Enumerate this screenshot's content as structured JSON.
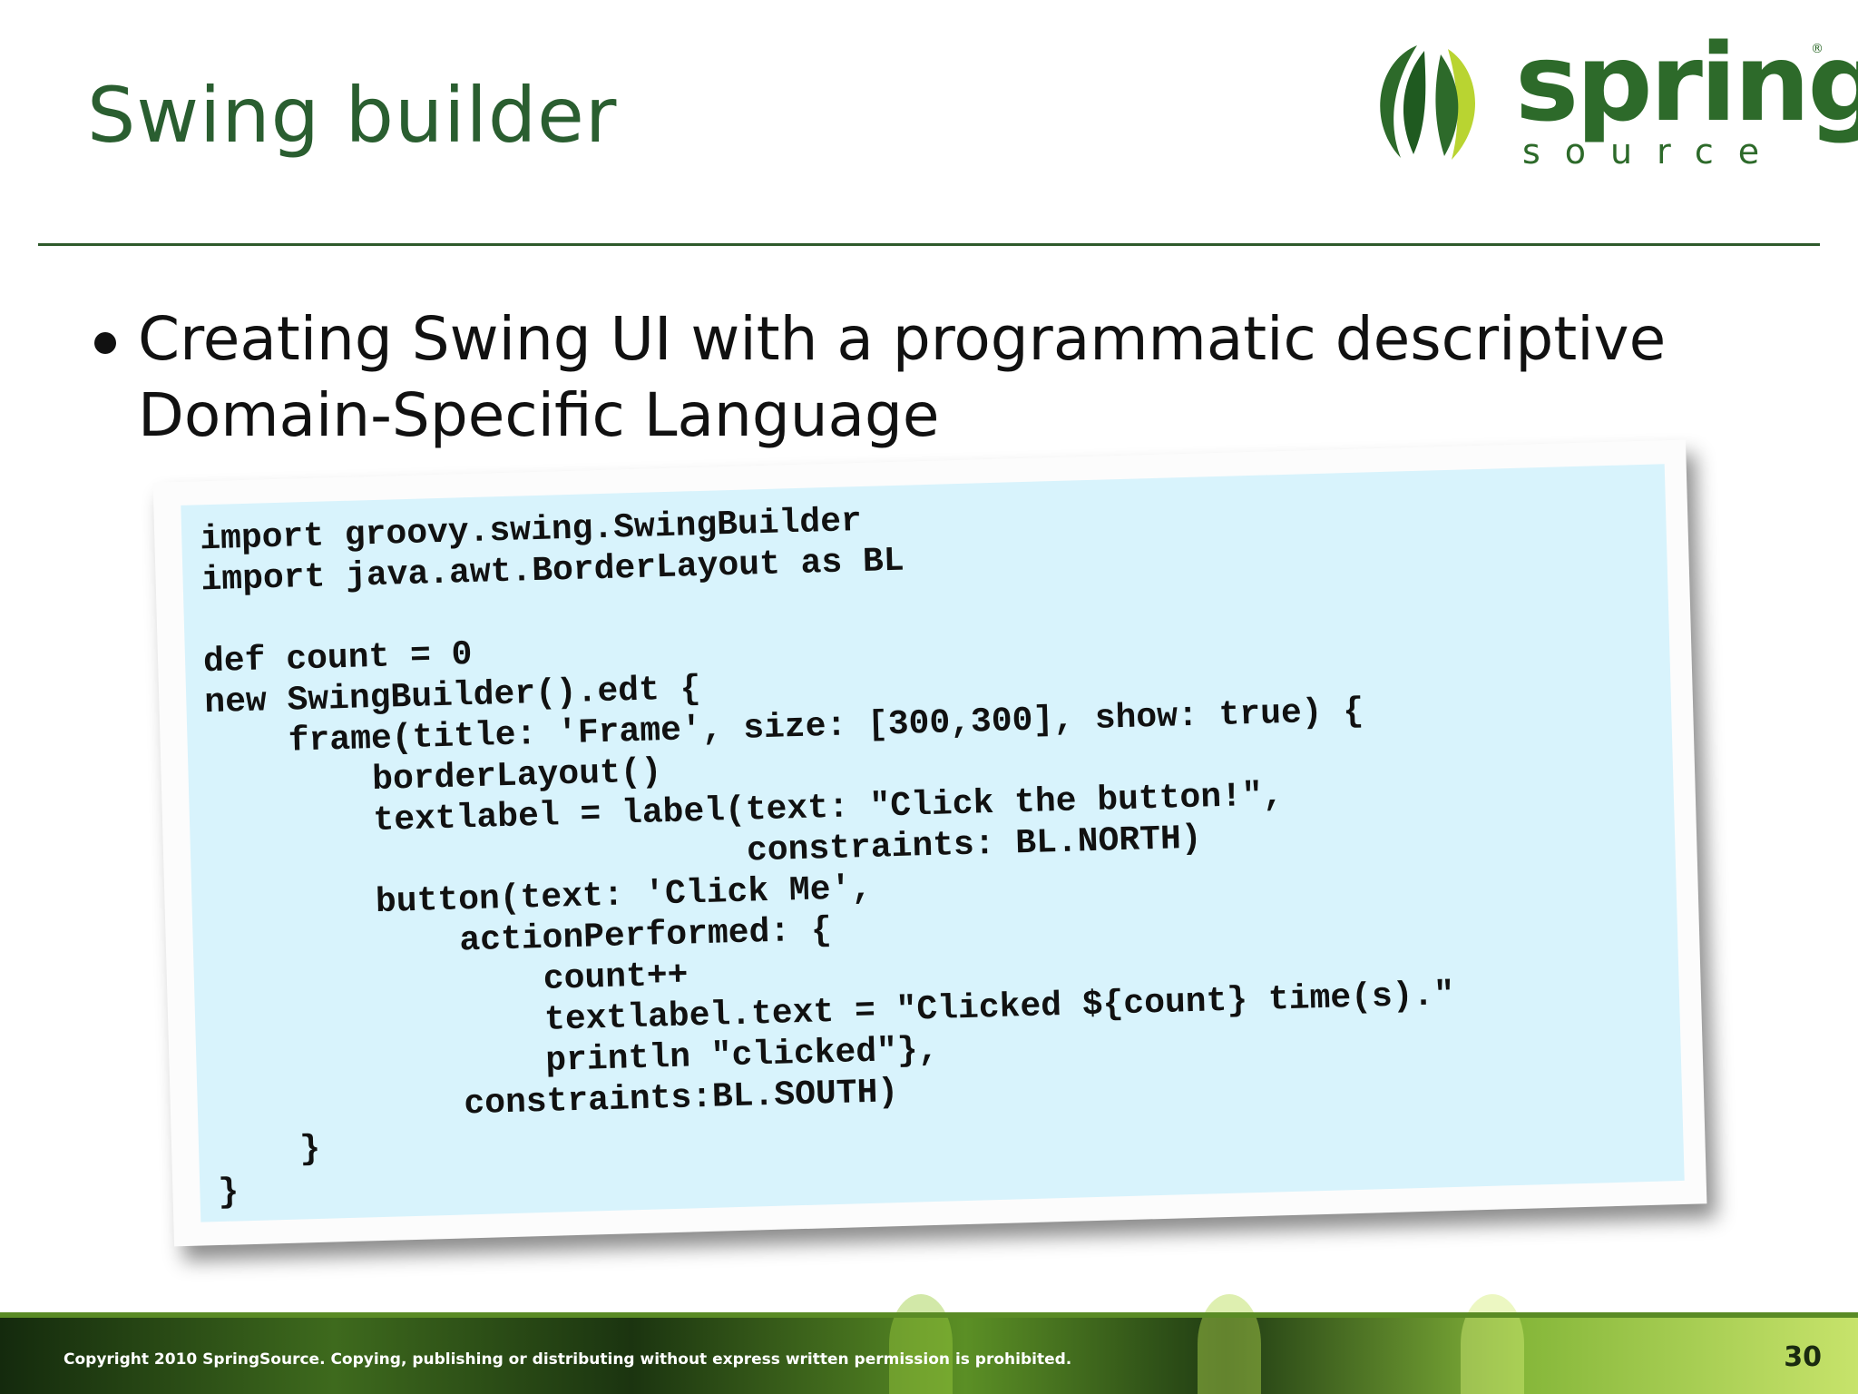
{
  "slide": {
    "title": "Swing builder",
    "bullet": "Creating Swing UI with a programmatic descriptive Domain-Specific Language",
    "code": "import groovy.swing.SwingBuilder\nimport java.awt.BorderLayout as BL\n\ndef count = 0\nnew SwingBuilder().edt {\n    frame(title: 'Frame', size: [300,300], show: true) {\n        borderLayout()\n        textlabel = label(text: \"Click the button!\",\n                          constraints: BL.NORTH)\n        button(text: 'Click Me',\n            actionPerformed: {\n                count++\n                textlabel.text = \"Clicked ${count} time(s).\"\n                println \"clicked\"},\n            constraints:BL.SOUTH)\n    }\n}",
    "page_number": "30"
  },
  "logo": {
    "word": "spring",
    "sub": "source",
    "reg": "®",
    "colors": {
      "dark_green": "#2d6a2a",
      "light_green": "#b9d431"
    }
  },
  "footer": {
    "copyright": "Copyright 2010 SpringSource.  Copying, publishing or distributing without express written permission is prohibited."
  },
  "colors": {
    "title": "#2a5e30",
    "rule": "#2e5a2c",
    "code_background": "#d8f3fc"
  }
}
